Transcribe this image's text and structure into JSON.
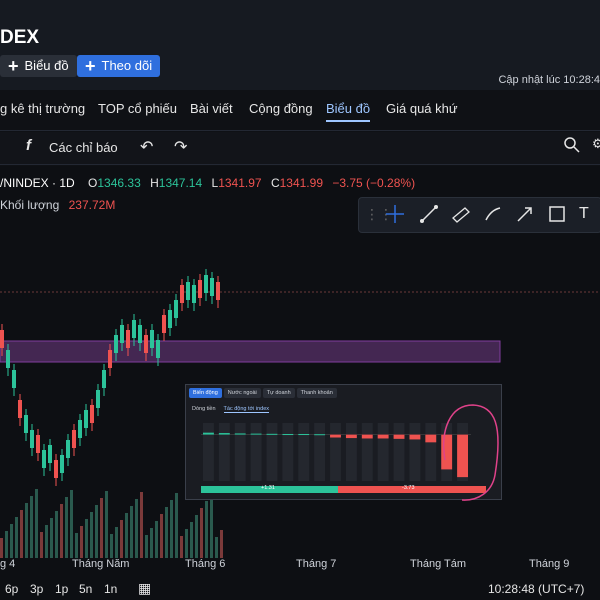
{
  "header": {
    "title": "DEX",
    "btn_chart": "Biểu đồ",
    "btn_follow": "Theo dõi",
    "update_text": "Cập nhật lúc  10:28:4"
  },
  "tabs": [
    {
      "label": "g kê thị trường"
    },
    {
      "label": "TOP cổ phiếu"
    },
    {
      "label": "Bài viết"
    },
    {
      "label": "Cộng đồng"
    },
    {
      "label": "Biểu đồ"
    },
    {
      "label": "Giá quá khứ"
    }
  ],
  "toolbar": {
    "indicators": "Các chỉ báo"
  },
  "legend": {
    "symbol": "/NINDEX · 1D",
    "o_label": "O",
    "o": "1346.33",
    "h_label": "H",
    "h": "1347.14",
    "l_label": "L",
    "l": "1341.97",
    "c_label": "C",
    "c": "1341.99",
    "chg": "−3.75 (−0.28%)",
    "vol_label": "Khối lượng",
    "vol": "237.72M"
  },
  "xaxis": [
    "g 4",
    "Tháng Năm",
    "Tháng 6",
    "Tháng 7",
    "Tháng Tám",
    "Tháng 9"
  ],
  "bottom": {
    "ranges": [
      "6p",
      "3p",
      "1p",
      "5n",
      "1n"
    ],
    "time": "10:28:48 (UTC+7)"
  },
  "panel": {
    "tabs": [
      "Biến động",
      "Nước ngoài",
      "Tự doanh",
      "Thanh khoản"
    ],
    "subtabs": [
      "Dòng tiền",
      "Tác động tới index"
    ],
    "bar_left": "+1.31",
    "bar_right": "-3.73"
  },
  "chart_data": {
    "type": "bar",
    "title": "",
    "values": [
      0.1,
      0.08,
      0.06,
      0.05,
      0.04,
      0.03,
      0.03,
      0.02,
      -0.15,
      -0.18,
      -0.2,
      -0.2,
      -0.22,
      -0.25,
      -0.4,
      -1.8,
      -2.2
    ],
    "ylim": [
      -2.4,
      0.6
    ]
  },
  "colors": {
    "up": "#2cc39a",
    "down": "#ef5350",
    "accent": "#2f6fde",
    "zone": "#8e44ad"
  }
}
